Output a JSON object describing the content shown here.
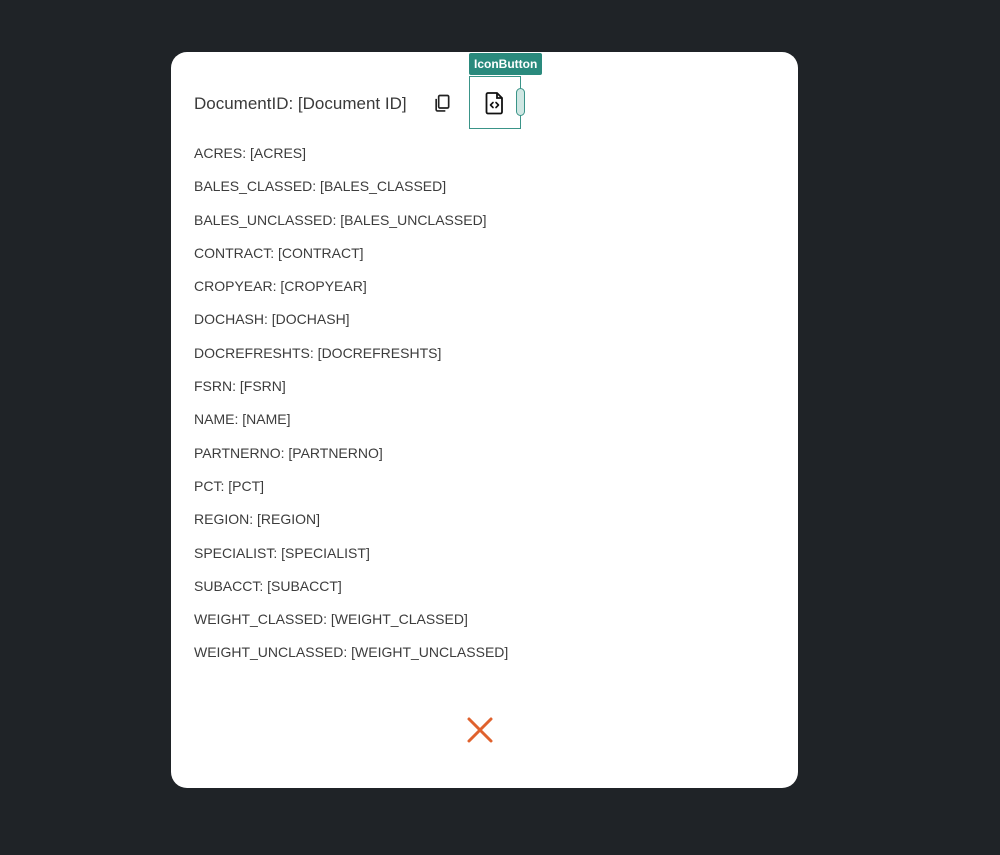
{
  "dialog": {
    "title": "DocumentID: [Document ID]",
    "tooltip_label": "IconButton",
    "fields": [
      "ACRES: [ACRES]",
      "BALES_CLASSED: [BALES_CLASSED]",
      "BALES_UNCLASSED: [BALES_UNCLASSED]",
      "CONTRACT: [CONTRACT]",
      "CROPYEAR: [CROPYEAR]",
      "DOCHASH: [DOCHASH]",
      "DOCREFRESHTS: [DOCREFRESHTS]",
      "FSRN: [FSRN]",
      "NAME: [NAME]",
      "PARTNERNO: [PARTNERNO]",
      "PCT: [PCT]",
      "REGION: [REGION]",
      "SPECIALIST: [SPECIALIST]",
      "SUBACCT: [SUBACCT]",
      "WEIGHT_CLASSED: [WEIGHT_CLASSED]",
      "WEIGHT_UNCLASSED: [WEIGHT_UNCLASSED]"
    ]
  },
  "icons": {
    "copy": "copy-icon",
    "code_file": "file-code-icon",
    "close": "close-icon"
  },
  "colors": {
    "background": "#1f2327",
    "card": "#ffffff",
    "accent_teal": "#2a8a7d",
    "close_orange": "#e0622e"
  }
}
